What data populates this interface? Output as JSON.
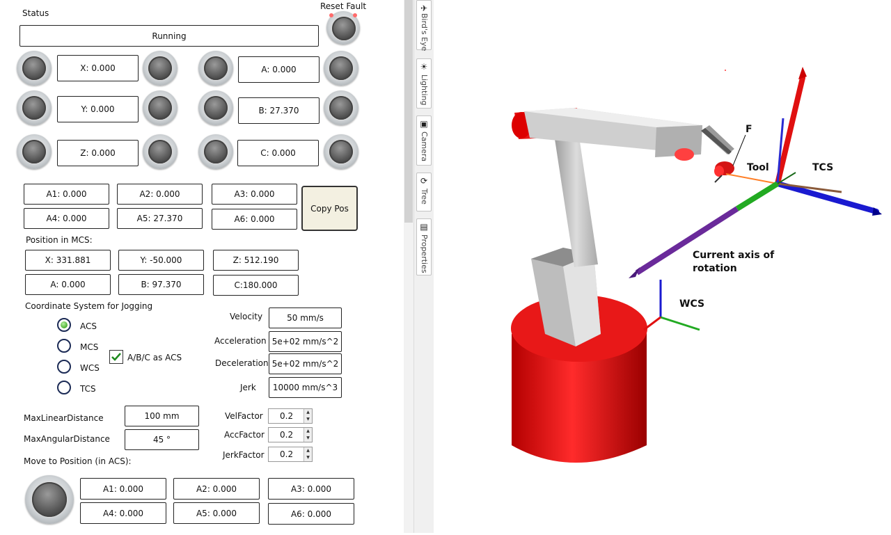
{
  "status": {
    "label": "Status",
    "value": "Running",
    "reset_fault_label": "Reset Fault"
  },
  "jog_axes": {
    "left": [
      "X: 0.000",
      "Y: 0.000",
      "Z: 0.000"
    ],
    "right": [
      "A: 0.000",
      "B: 27.370",
      "C: 0.000"
    ]
  },
  "acs_positions": [
    "A1: 0.000",
    "A2: 0.000",
    "A3: 0.000",
    "A4: 0.000",
    "A5: 27.370",
    "A6: 0.000"
  ],
  "copy_pos_label": "Copy Pos",
  "mcs": {
    "label": "Position in MCS:",
    "values": [
      "X: 331.881",
      "Y: -50.000",
      "Z: 512.190",
      "A: 0.000",
      "B: 97.370",
      "C:180.000"
    ]
  },
  "coord_system": {
    "label": "Coordinate System for Jogging",
    "options": [
      "ACS",
      "MCS",
      "WCS",
      "TCS"
    ],
    "selected": "ACS",
    "abc_as_acs_label": "A/B/C as ACS",
    "abc_as_acs_checked": true
  },
  "motion": {
    "velocity_label": "Velocity",
    "velocity": "50 mm/s",
    "acceleration_label": "Acceleration",
    "acceleration": "5e+02 mm/s^2",
    "deceleration_label": "Deceleration",
    "deceleration": "5e+02 mm/s^2",
    "jerk_label": "Jerk",
    "jerk": "10000 mm/s^3"
  },
  "limits": {
    "max_linear_label": "MaxLinearDistance",
    "max_linear": "100 mm",
    "max_angular_label": "MaxAngularDistance",
    "max_angular": "45 °"
  },
  "factors": {
    "vel_label": "VelFactor",
    "vel": "0.2",
    "acc_label": "AccFactor",
    "acc": "0.2",
    "jerk_label": "JerkFactor",
    "jerk": "0.2"
  },
  "move_to": {
    "label": "Move to Position (in ACS):",
    "values": [
      "A1: 0.000",
      "A2: 0.000",
      "A3: 0.000",
      "A4: 0.000",
      "A5: 0.000",
      "A6: 0.000"
    ]
  },
  "side_tabs": [
    "Bird's Eye",
    "Lighting",
    "Camera",
    "Tree",
    "Properties"
  ],
  "viewport": {
    "labels": {
      "f": "F",
      "tool": "Tool",
      "tcs": "TCS",
      "axis_rotation_line1": "Current axis of",
      "axis_rotation_line2": "rotation",
      "wcs": "WCS"
    },
    "colors": {
      "robot_red": "#e01010",
      "arm_gray": "#bdbdbd",
      "axis_red": "#e01010",
      "axis_green": "#22aa22",
      "axis_blue": "#1a1ad0",
      "rotation_purple": "#6a2a9a",
      "tool_link_orange": "#ff7f27"
    }
  }
}
